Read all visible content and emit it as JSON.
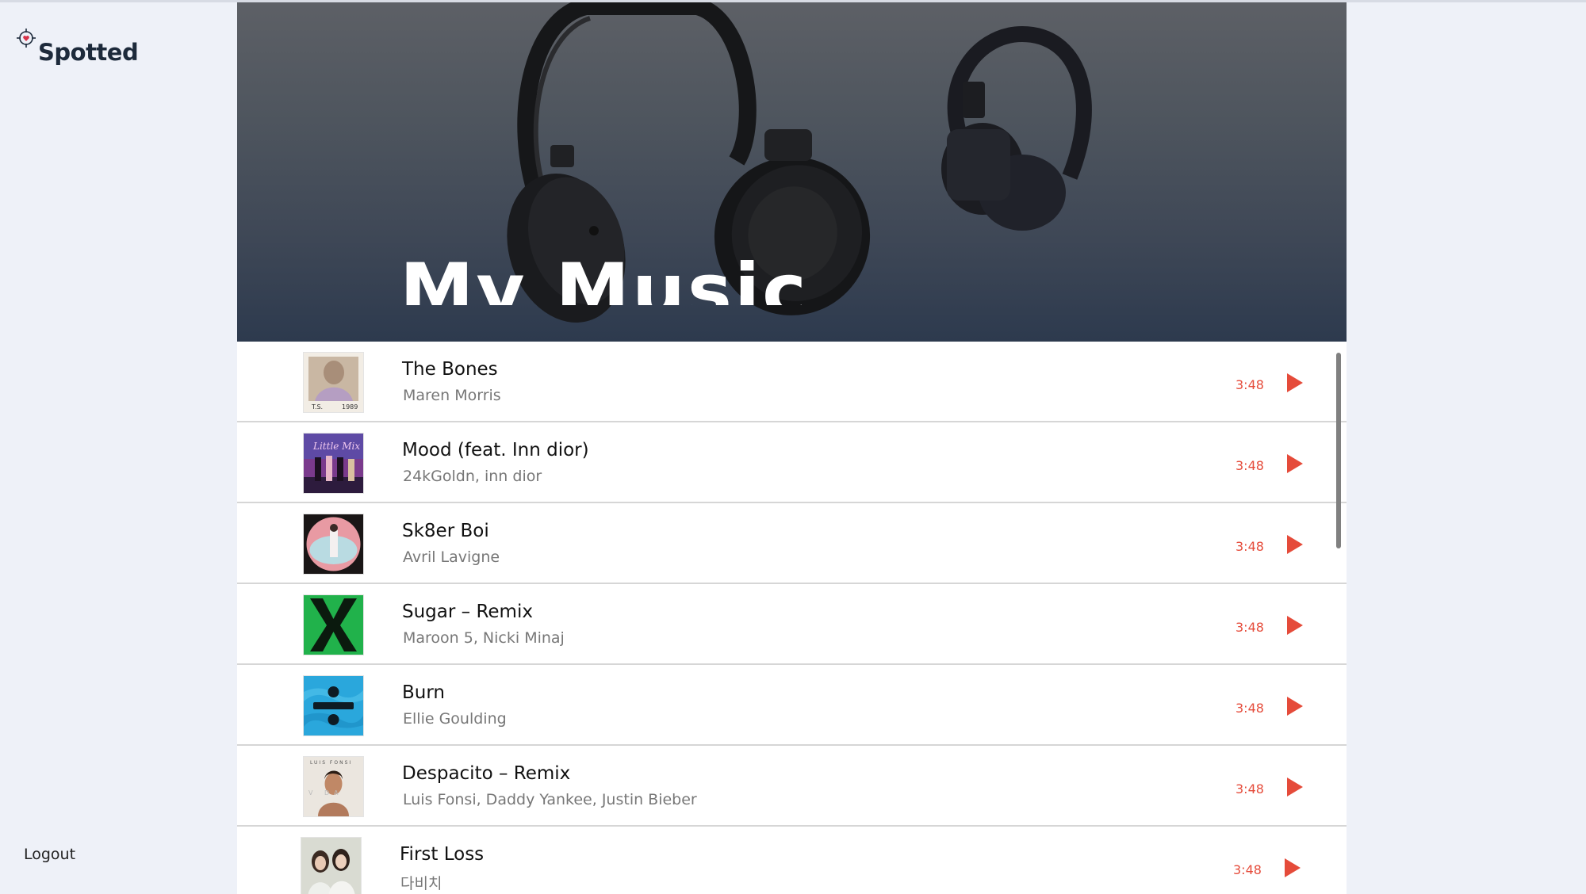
{
  "app": {
    "name": "Spotted"
  },
  "sidebar": {
    "logout_label": "Logout"
  },
  "hero": {
    "title": "My Music"
  },
  "colors": {
    "accent": "#e54b3a",
    "brand": "#1d2a3b",
    "sidebar_bg": "#eef1f8"
  },
  "tracks": [
    {
      "title": "The Bones",
      "artist": "Maren Morris",
      "duration": "3:48",
      "cover": "1989-album-cover"
    },
    {
      "title": "Mood (feat. Inn dior)",
      "artist": "24kGoldn, inn dior",
      "duration": "3:48",
      "cover": "little-mix-album-cover"
    },
    {
      "title": "Sk8er Boi",
      "artist": "Avril Lavigne",
      "duration": "3:48",
      "cover": "pink-circle-album-cover"
    },
    {
      "title": "Sugar – Remix",
      "artist": "Maroon 5, Nicki Minaj",
      "duration": "3:48",
      "cover": "x-album-cover"
    },
    {
      "title": "Burn",
      "artist": "Ellie Goulding",
      "duration": "3:48",
      "cover": "divide-album-cover"
    },
    {
      "title": "Despacito – Remix",
      "artist": "Luis Fonsi, Daddy Yankee, Justin Bieber",
      "duration": "3:48",
      "cover": "vida-album-cover"
    },
    {
      "title": "First Loss",
      "artist": "다비치",
      "duration": "3:48",
      "cover": "davichi-album-cover"
    }
  ]
}
